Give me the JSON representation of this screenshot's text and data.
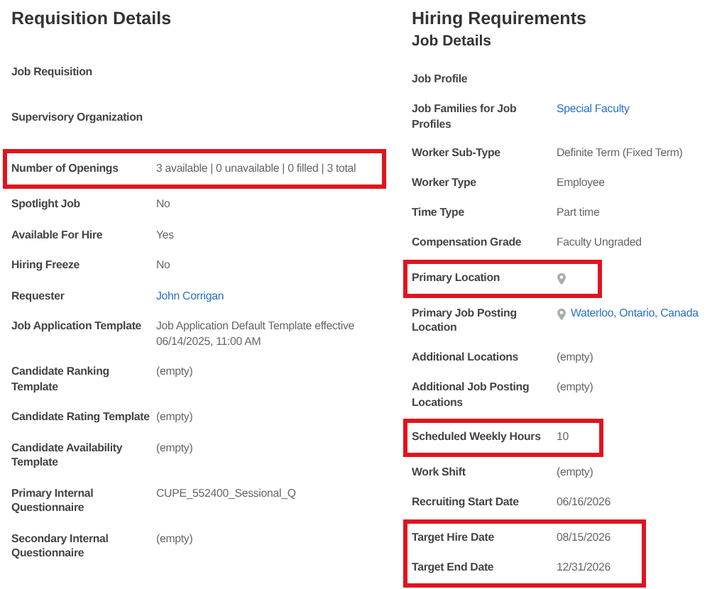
{
  "columns": [
    {
      "title": "Requisition Details",
      "groups": [
        {
          "highlighted": false,
          "rows": [
            {
              "label": "Job Requisition"
            },
            {
              "label": "Supervisory Organization"
            }
          ]
        },
        {
          "highlighted": true,
          "rows": [
            {
              "label": "Number of Openings",
              "value": "3 available | 0 unavailable | 0 filled | 3 total",
              "kind": "text"
            }
          ]
        },
        {
          "highlighted": false,
          "rows": [
            {
              "label": "Spotlight Job",
              "value": "No",
              "kind": "text"
            },
            {
              "label": "Available For Hire",
              "value": "Yes",
              "kind": "text"
            },
            {
              "label": "Hiring Freeze",
              "value": "No",
              "kind": "text"
            },
            {
              "label": "Requester",
              "value": "John Corrigan",
              "kind": "link"
            },
            {
              "label": "Job Application Template",
              "value": "Job Application Default Template effective 06/14/2025, 11:00 AM",
              "kind": "text"
            },
            {
              "label": "Candidate Ranking Template",
              "value": "(empty)",
              "kind": "text"
            },
            {
              "label": "Candidate Rating Template",
              "value": "(empty)",
              "kind": "text"
            },
            {
              "label": "Candidate Availability Template",
              "value": "(empty)",
              "kind": "text"
            },
            {
              "label": "Primary Internal Questionnaire",
              "value": "CUPE_552400_Sessional_Q",
              "kind": "text"
            },
            {
              "label": "Secondary Internal Questionnaire",
              "value": "(empty)",
              "kind": "text"
            }
          ]
        }
      ]
    },
    {
      "title": "Hiring Requirements",
      "subtitle": "Job Details",
      "groups": [
        {
          "highlighted": false,
          "rows": [
            {
              "label": "Job Profile"
            },
            {
              "label": "Job Families for Job Profiles",
              "value": "Special Faculty",
              "kind": "link"
            },
            {
              "label": "Worker Sub-Type",
              "value": "Definite Term (Fixed Term)",
              "kind": "text"
            },
            {
              "label": "Worker Type",
              "value": "Employee",
              "kind": "text"
            },
            {
              "label": "Time Type",
              "value": "Part time",
              "kind": "text"
            },
            {
              "label": "Compensation Grade",
              "value": "Faculty Ungraded",
              "kind": "text"
            }
          ]
        },
        {
          "highlighted": true,
          "rows": [
            {
              "label": "Primary Location",
              "kind": "location"
            }
          ]
        },
        {
          "highlighted": false,
          "rows": [
            {
              "label": "Primary Job Posting Location",
              "value": "Waterloo, Ontario, Canada",
              "kind": "location"
            },
            {
              "label": "Additional Locations",
              "value": "(empty)",
              "kind": "text"
            },
            {
              "label": "Additional Job Posting Locations",
              "value": "(empty)",
              "kind": "text"
            }
          ]
        },
        {
          "highlighted": true,
          "rows": [
            {
              "label": "Scheduled Weekly Hours",
              "value": "10",
              "kind": "text"
            }
          ]
        },
        {
          "highlighted": false,
          "rows": [
            {
              "label": "Work Shift",
              "value": "(empty)",
              "kind": "text"
            },
            {
              "label": "Recruiting Start Date",
              "value": "06/16/2026",
              "kind": "text"
            }
          ]
        },
        {
          "highlighted": true,
          "rows": [
            {
              "label": "Target Hire Date",
              "value": "08/15/2026",
              "kind": "text"
            },
            {
              "label": "Target End Date",
              "value": "12/31/2026",
              "kind": "text"
            }
          ]
        }
      ]
    }
  ]
}
